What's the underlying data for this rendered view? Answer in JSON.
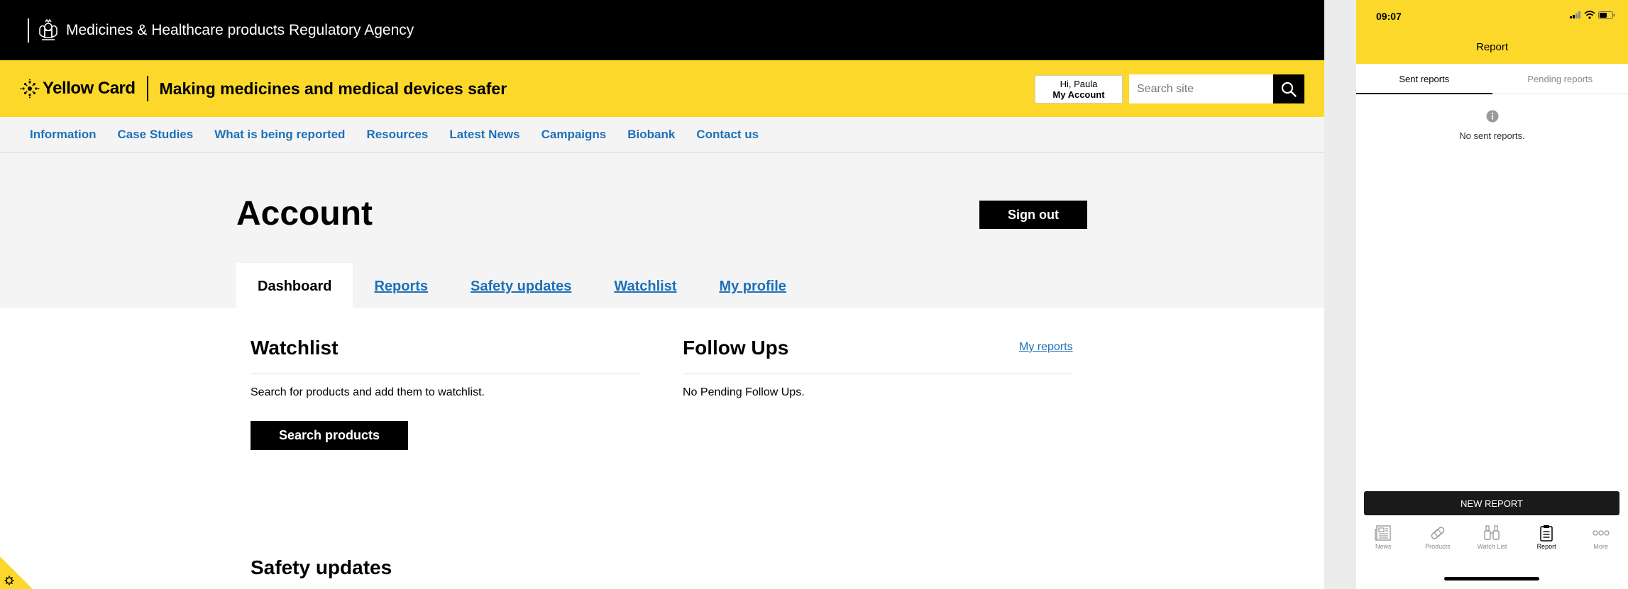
{
  "agency": {
    "name": "Medicines & Healthcare products Regulatory Agency"
  },
  "brand": {
    "logo_text": "Yellow Card",
    "tagline": "Making medicines and medical devices safer"
  },
  "account_menu": {
    "greeting": "Hi, Paula",
    "label": "My Account"
  },
  "search": {
    "placeholder": "Search site"
  },
  "nav": [
    "Information",
    "Case Studies",
    "What is being reported",
    "Resources",
    "Latest News",
    "Campaigns",
    "Biobank",
    "Contact us"
  ],
  "page": {
    "title": "Account",
    "sign_out": "Sign out"
  },
  "tabs": [
    "Dashboard",
    "Reports",
    "Safety updates",
    "Watchlist",
    "My profile"
  ],
  "watchlist": {
    "title": "Watchlist",
    "text": "Search for products and add them to watchlist.",
    "button": "Search products"
  },
  "follow_ups": {
    "title": "Follow Ups",
    "link": "My reports",
    "text": "No Pending Follow Ups."
  },
  "safety_updates": {
    "title": "Safety updates"
  },
  "phone": {
    "time": "09:07",
    "title": "Report",
    "tabs": [
      "Sent reports",
      "Pending reports"
    ],
    "empty_text": "No sent reports.",
    "new_report": "NEW REPORT",
    "bottom_nav": [
      "News",
      "Products",
      "Watch List",
      "Report",
      "More"
    ]
  },
  "colors": {
    "brand_yellow": "#fcd82a",
    "link_blue": "#1d70b8",
    "black": "#000000"
  }
}
